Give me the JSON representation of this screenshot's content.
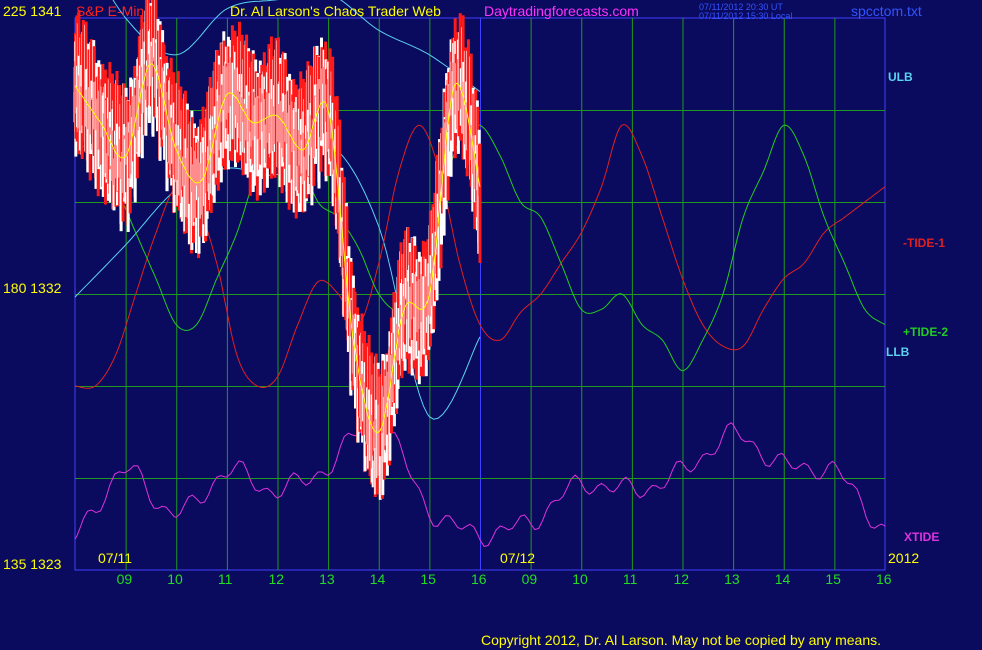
{
  "header": {
    "price_top": "225 1341",
    "instrument": "S&P E-Mini",
    "title": "Dr. Al Larson's Chaos Trader Web",
    "site": "Daytradingforecasts.com",
    "time_utc": "07/11/2012 20:30 UT",
    "time_local": "07/11/2012 15:30 Local",
    "file": "spcctom.txt"
  },
  "left_axis": {
    "mid": "180 1332",
    "bottom": "135 1323"
  },
  "right_labels": {
    "ulb": "ULB",
    "tide1": "-TIDE-1",
    "tide2": "+TIDE-2",
    "llb": "LLB",
    "xtide": "XTIDE",
    "year": "2012"
  },
  "dates": [
    "07/11",
    "07/12"
  ],
  "hours": [
    "09",
    "10",
    "11",
    "12",
    "13",
    "14",
    "15",
    "16",
    "09",
    "10",
    "11",
    "12",
    "13",
    "14",
    "15",
    "16"
  ],
  "copyright": "Copyright 2012, Dr. Al Larson. May not be copied by any means.",
  "colors": {
    "background": "#0a0a5e",
    "grid": "#1f9a1f",
    "price_up": "#ffffff",
    "price_down": "#ff1a1a",
    "moving_average": "#ffff00",
    "band": "#5bd3f0",
    "tide1": "#e02020",
    "tide2": "#22cc22",
    "xtide": "#dd33dd",
    "day_divider": "#4040ff"
  },
  "chart_data": {
    "type": "line",
    "title": "S&P E-Mini",
    "price_axis": {
      "top": 1341,
      "mid": 1332,
      "bottom": 1323
    },
    "cycle_axis": {
      "top": 225,
      "mid": 180,
      "bottom": 135
    },
    "x_ticks": [
      "09",
      "10",
      "11",
      "12",
      "13",
      "14",
      "15",
      "16",
      "09",
      "10",
      "11",
      "12",
      "13",
      "14",
      "15",
      "16"
    ],
    "dates": [
      "07/11",
      "07/12"
    ],
    "series": [
      {
        "name": "ULB",
        "role": "band_upper",
        "x": [
          0,
          1,
          2,
          3,
          4,
          5,
          6,
          7,
          8
        ],
        "y": [
          1343.8,
          1341.0,
          1339.8,
          1341.3,
          1341.6,
          1341.8,
          1340.6,
          1339.8,
          1338.6
        ]
      },
      {
        "name": "LLB",
        "role": "band_lower",
        "x": [
          0,
          1,
          2,
          3,
          4,
          5,
          6,
          7,
          8
        ],
        "y": [
          1331.9,
          1333.6,
          1335.4,
          1336.1,
          1335.9,
          1336.9,
          1334.2,
          1328.0,
          1330.6
        ]
      },
      {
        "name": "-TIDE-1",
        "role": "cycle",
        "x": [
          0,
          0.4,
          0.8,
          1.2,
          1.6,
          2.0,
          2.4,
          2.8,
          3.2,
          3.6,
          4.0,
          4.4,
          4.8,
          5.2,
          5.6,
          6.0,
          6.4,
          6.8,
          7.2,
          7.6,
          8.0,
          8.4,
          8.8,
          9.2,
          9.6,
          10.0,
          10.4,
          10.8,
          11.2,
          11.6,
          12.0,
          12.4,
          12.8,
          13.2,
          13.6,
          14.0,
          14.4,
          14.8,
          15.2,
          15.6,
          16.0
        ],
        "y": [
          1329,
          1329,
          1330,
          1332,
          1334,
          1335.5,
          1335,
          1333,
          1330,
          1329,
          1329.3,
          1331,
          1332.4,
          1332,
          1331,
          1333,
          1336,
          1337.5,
          1336,
          1333,
          1331,
          1330.5,
          1331.4,
          1332,
          1333,
          1334,
          1335.5,
          1337.5,
          1336.5,
          1334.5,
          1332.5,
          1331,
          1330.3,
          1330.3,
          1331.5,
          1332.5,
          1333,
          1334,
          1334.5,
          1335,
          1335.5
        ]
      },
      {
        "name": "+TIDE-2",
        "role": "cycle",
        "x": [
          0,
          0.4,
          0.8,
          1.2,
          1.6,
          2.0,
          2.4,
          2.8,
          3.2,
          3.6,
          4.0,
          4.4,
          4.8,
          5.2,
          5.6,
          6.0,
          6.4,
          6.8,
          7.2,
          7.6,
          8.0,
          8.4,
          8.8,
          9.2,
          9.6,
          10.0,
          10.4,
          10.8,
          11.2,
          11.6,
          12.0,
          12.4,
          12.8,
          13.2,
          13.6,
          14.0,
          14.4,
          14.8,
          15.2,
          15.6,
          16.0
        ],
        "y": [
          1337,
          1336.5,
          1335.5,
          1334,
          1332.5,
          1331,
          1331,
          1332.5,
          1334,
          1336,
          1337,
          1336.5,
          1335,
          1334.5,
          1333.5,
          1332,
          1331.5,
          1332.5,
          1335,
          1337,
          1337.5,
          1336.5,
          1335,
          1334.5,
          1333,
          1331.5,
          1331.5,
          1332,
          1331,
          1330.5,
          1329.5,
          1330.5,
          1332,
          1334.5,
          1336,
          1337.5,
          1336.5,
          1334.5,
          1333,
          1331.5,
          1331
        ]
      },
      {
        "name": "XTIDE",
        "role": "oscillator",
        "x": [
          0,
          1,
          2,
          3,
          4,
          5,
          6,
          7,
          8,
          9,
          10,
          11,
          12,
          13,
          14,
          15,
          16
        ],
        "y": [
          140,
          151,
          144,
          151,
          148,
          152,
          159,
          145,
          141,
          143,
          149,
          148,
          151,
          157,
          152,
          151,
          141
        ]
      }
    ],
    "price_bars": {
      "note": "Intraday OHLC bars for 07/11 09:00-16:00 with 3-bar average",
      "x": [
        0,
        0.5,
        1,
        1.5,
        2,
        2.5,
        3,
        3.5,
        4,
        4.5,
        5,
        5.5,
        6,
        6.5,
        7,
        7.5,
        8
      ],
      "close": [
        1338.8,
        1337.6,
        1336.5,
        1339.5,
        1336.7,
        1335.7,
        1338.5,
        1337.6,
        1337.8,
        1336.7,
        1338.0,
        1330.5,
        1327.5,
        1331.5,
        1332.0,
        1338.8,
        1335.5
      ]
    }
  }
}
